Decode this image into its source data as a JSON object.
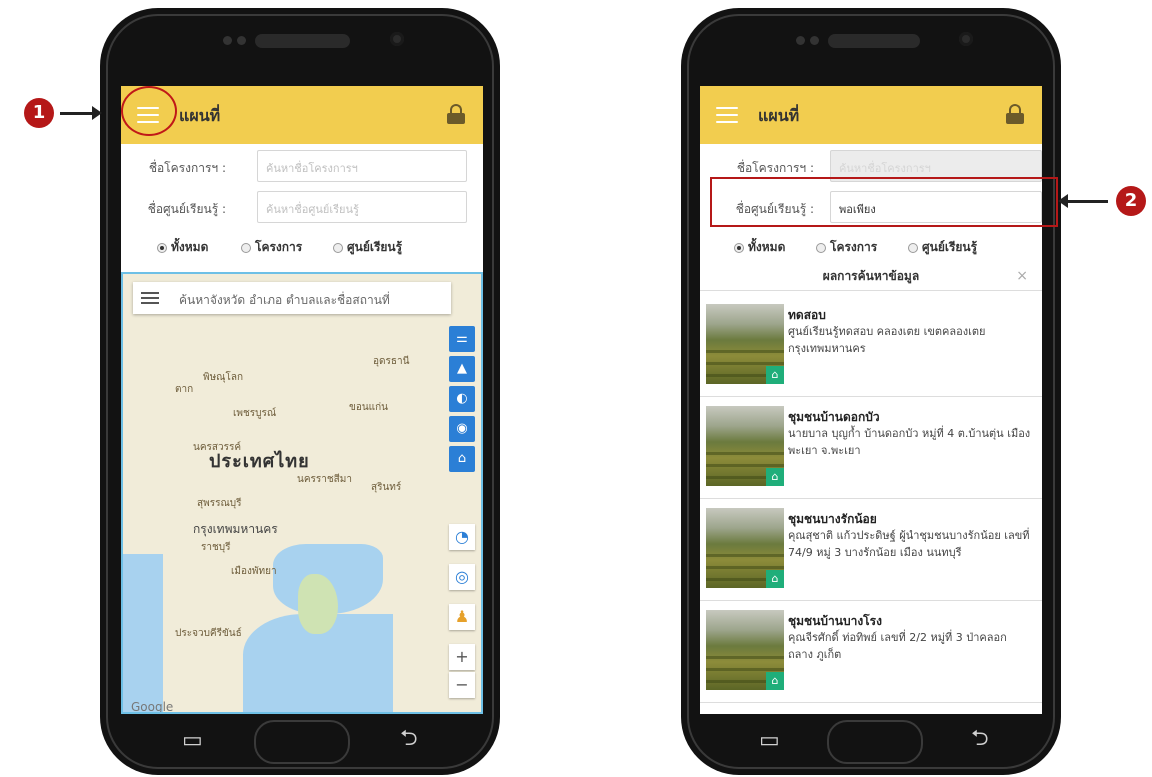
{
  "phone1": {
    "header_title": "แผนที่",
    "project_label": "ชื่อโครงการฯ :",
    "project_placeholder": "ค้นหาชื่อโครงการฯ",
    "center_label": "ชื่อศูนย์เรียนรู้ :",
    "center_placeholder": "ค้นหาชื่อศูนย์เรียนรู้",
    "filter_all": "ทั้งหมด",
    "filter_project": "โครงการ",
    "filter_center": "ศูนย์เรียนรู้",
    "map_search_placeholder": "ค้นหาจังหวัด อำเภอ ตำบลและชื่อสถานที่",
    "map_labels": {
      "country": "ประเทศไทย",
      "bangkok": "กรุงเทพมหานคร",
      "phitsanulok": "พิษณุโลก",
      "khonkaen": "ขอนแก่น",
      "udon": "อุดรธานี",
      "nakhonsawan": "นครสวรรค์",
      "nakhonratchasima": "นครราชสีมา",
      "suphanburi": "สุพรรณบุรี",
      "pattaya": "เมืองพัทยา",
      "surin": "สุรินทร์",
      "tak": "ตาก",
      "phetchabun": "เพชรบูรณ์",
      "ratchaburi": "ราชบุรี",
      "prachuap": "ประจวบคีรีขันธ์",
      "google": "Google"
    },
    "map_zoom_in": "+",
    "map_zoom_out": "−"
  },
  "callouts": {
    "step1": "1",
    "step2": "2"
  },
  "phone2": {
    "header_title": "แผนที่",
    "project_label": "ชื่อโครงการฯ :",
    "project_placeholder": "ค้นหาชื่อโครงการฯ",
    "center_label": "ชื่อศูนย์เรียนรู้ :",
    "center_value": "พอเพียง",
    "filter_all": "ทั้งหมด",
    "filter_project": "โครงการ",
    "filter_center": "ศูนย์เรียนรู้",
    "results_title": "ผลการค้นหาข้อมูล",
    "results_close": "×",
    "results": [
      {
        "name": "ทดสอบ",
        "address": "ศูนย์เรียนรู้ทดสอบ คลองเตย เขตคลองเตย กรุงเทพมหานคร"
      },
      {
        "name": "ชุมชนบ้านดอกบัว",
        "address": "นายบาล บุญก้ำ บ้านดอกบัว หมู่ที่ 4 ต.บ้านตุ่น เมืองพะเยา จ.พะเยา"
      },
      {
        "name": "ชุมชนบางรักน้อย",
        "address": "คุณสุชาติ แก้วประดิษฐ์ ผู้นำชุมชนบางรักน้อย เลขที่ 74/9 หมู่ 3 บางรักน้อย เมือง นนทบุรี"
      },
      {
        "name": "ชุมชนบ้านบางโรง",
        "address": "คุณจีรศักดิ์ ท่อทิพย์ เลขที่ 2/2 หมู่ที่ 3 ป่าคลอก ถลาง ภูเก็ต"
      }
    ]
  },
  "colors": {
    "appbar": "#f2cd4f",
    "callout": "#b51818",
    "map_tool": "#2b7fd6",
    "home_badge": "#1fae7a"
  },
  "icons": [
    "menu-icon",
    "lock-icon",
    "home-icon",
    "recent-apps-icon",
    "back-icon",
    "close-icon"
  ]
}
